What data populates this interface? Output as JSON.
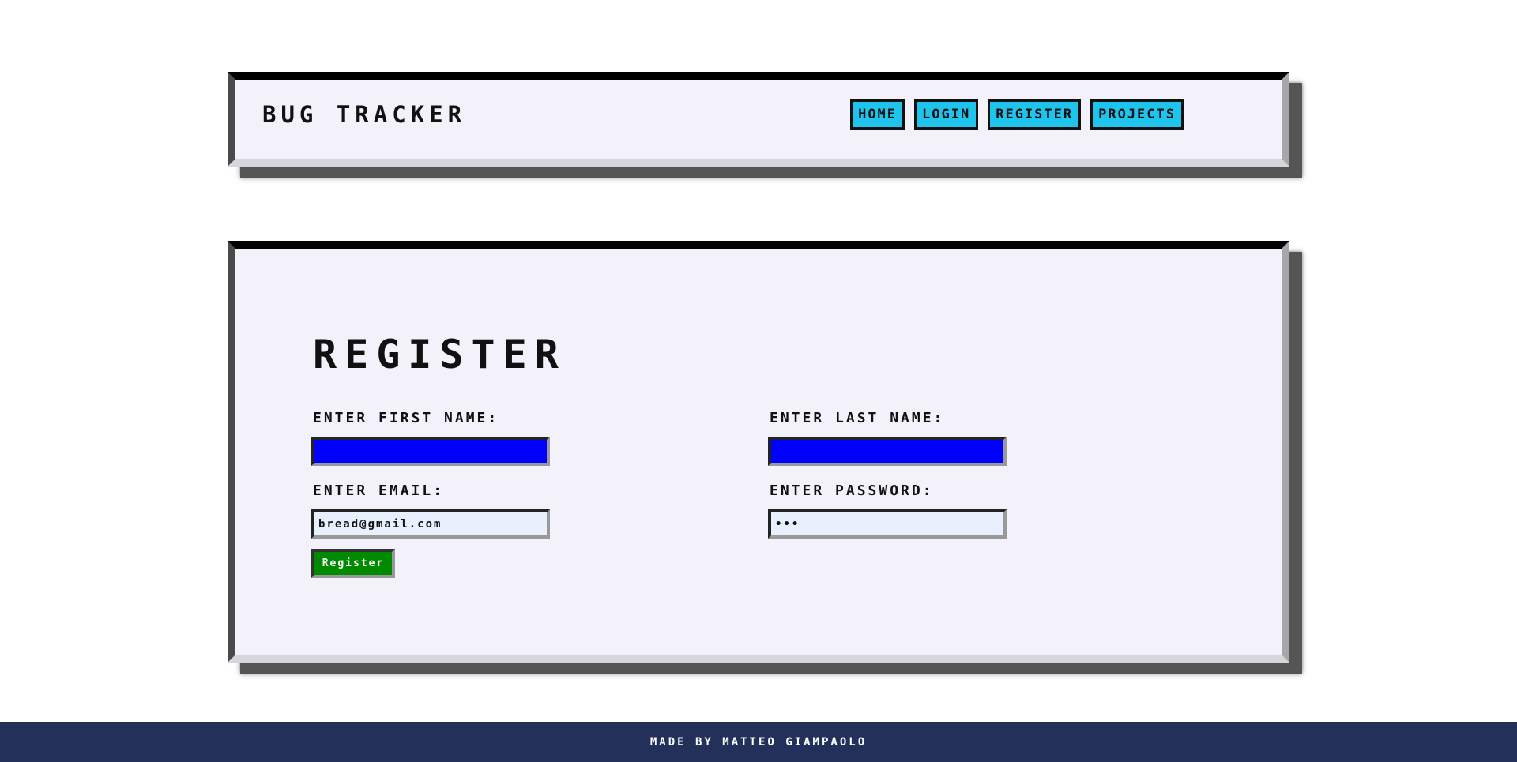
{
  "header": {
    "brand": "Bug Tracker",
    "nav": [
      {
        "label": "Home"
      },
      {
        "label": "Login"
      },
      {
        "label": "Register"
      },
      {
        "label": "Projects"
      }
    ]
  },
  "form": {
    "title": "Register",
    "first_name": {
      "label": "Enter first name:",
      "value": ""
    },
    "last_name": {
      "label": "Enter last name:",
      "value": ""
    },
    "email": {
      "label": "Enter email:",
      "value": "bread@gmail.com"
    },
    "password": {
      "label": "Enter password:",
      "value": "•••"
    },
    "submit_label": "Register"
  },
  "footer": {
    "text": "Made by Matteo Giampaolo"
  },
  "colors": {
    "nav_button": "#1ec4ec",
    "active_input": "#0000ff",
    "submit_button": "#008a00",
    "footer_bg": "#22305a",
    "panel_bg": "#f3f2fb"
  }
}
